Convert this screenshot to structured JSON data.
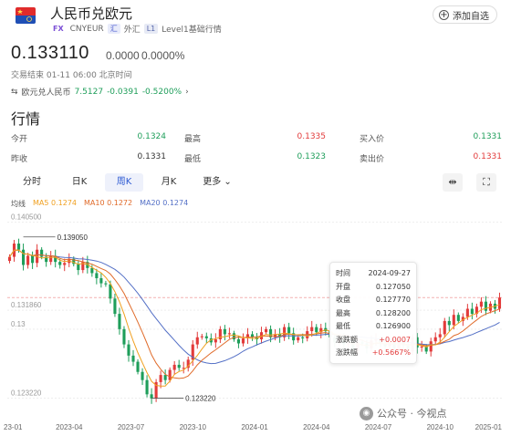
{
  "header": {
    "title": "人民币兑欧元",
    "fx_badge": "FX",
    "code": "CNYEUR",
    "market_badge": "外汇",
    "market_icon": "foreign-exchange-icon",
    "level_badge": "Level1基础行情",
    "level_icon": "level1-icon",
    "add_label": "添加自选"
  },
  "quote": {
    "price": "0.133110",
    "change": "0.0000",
    "change_pct": "0.0000%",
    "trade_status": "交易结束 01-11 06:00 北京时间",
    "related_label": "欧元兑人民币",
    "related_price": "7.5127",
    "related_change": "-0.0391",
    "related_change_pct": "-0.5200%"
  },
  "section_title": "行情",
  "stats": {
    "open_label": "今开",
    "open_value": "0.1324",
    "high_label": "最高",
    "high_value": "0.1335",
    "buy_label": "买入价",
    "buy_value": "0.1331",
    "prev_label": "昨收",
    "prev_value": "0.1331",
    "low_label": "最低",
    "low_value": "0.1323",
    "sell_label": "卖出价",
    "sell_value": "0.1331"
  },
  "tabs": {
    "timeshare": "分时",
    "day": "日K",
    "week": "周K",
    "month": "月K",
    "more": "更多",
    "active": "周K"
  },
  "legend": {
    "ma_label": "均线",
    "ma5": "MA5 0.1274",
    "ma10": "MA10 0.1272",
    "ma20": "MA20 0.1274"
  },
  "colors": {
    "up": "#e23b3b",
    "down": "#1e9e5a",
    "ma5": "#f0a020",
    "ma10": "#e06b2a",
    "ma20": "#5470c6",
    "accent": "#2f5bd3"
  },
  "tooltip": {
    "time_label": "时间",
    "time_value": "2024-09-27",
    "open_label": "开盘",
    "open_value": "0.127050",
    "close_label": "收盘",
    "close_value": "0.127770",
    "high_label": "最高",
    "high_value": "0.128200",
    "low_label": "最低",
    "low_value": "0.126900",
    "chg_label": "涨跌额",
    "chg_value": "+0.0007",
    "pct_label": "涨跌幅",
    "pct_value": "+0.5667%"
  },
  "watermark": "公众号 · 今视点",
  "chart_data": {
    "type": "candlestick",
    "ylim": [
      0.1213,
      0.141
    ],
    "y_ticks": [
      "0.140500",
      "0.131860",
      "0.13",
      "0.123220"
    ],
    "y_tick_values": [
      0.1405,
      0.13186,
      0.13,
      0.12322
    ],
    "x_ticks": [
      "23-01",
      "2023-04",
      "2023-07",
      "2023-10",
      "2024-01",
      "2024-04",
      "2024-07",
      "2024-10",
      "2025-01"
    ],
    "annotations": [
      {
        "label": "0.139050",
        "value": 0.13905,
        "x": "2023-01"
      },
      {
        "label": "0.123220",
        "value": 0.12322,
        "x": "2023-07"
      }
    ],
    "reference_line": 0.1331,
    "closes": [
      0.1371,
      0.1384,
      0.1378,
      0.1363,
      0.1372,
      0.1365,
      0.1378,
      0.1371,
      0.1366,
      0.1372,
      0.1366,
      0.1363,
      0.1365,
      0.1369,
      0.1364,
      0.1358,
      0.1366,
      0.136,
      0.1355,
      0.135,
      0.1345,
      0.1344,
      0.133,
      0.1315,
      0.13,
      0.1285,
      0.1274,
      0.1268,
      0.1258,
      0.125,
      0.1236,
      0.1232,
      0.1248,
      0.1255,
      0.125,
      0.126,
      0.1265,
      0.1262,
      0.1262,
      0.127,
      0.1285,
      0.1292,
      0.1293,
      0.1291,
      0.1287,
      0.129,
      0.13,
      0.1295,
      0.1296,
      0.129,
      0.1286,
      0.1291,
      0.1295,
      0.1292,
      0.129,
      0.1297,
      0.13,
      0.1292,
      0.1295,
      0.1292,
      0.1302,
      0.1296,
      0.1289,
      0.1292,
      0.1291,
      0.1298,
      0.1302,
      0.1297,
      0.1301,
      0.1298,
      0.1292,
      0.1287,
      0.129,
      0.1285,
      0.1286,
      0.1279,
      0.1287,
      0.1286,
      0.1281,
      0.1289,
      0.129,
      0.1286,
      0.1283,
      0.1288,
      0.1281,
      0.1288,
      0.1284,
      0.1278,
      0.1292,
      0.1282,
      0.1283,
      0.1278,
      0.1288,
      0.1292,
      0.1295,
      0.1308,
      0.1304,
      0.1314,
      0.1308,
      0.1312,
      0.132,
      0.1315,
      0.1322,
      0.1327,
      0.1318,
      0.1325,
      0.132,
      0.1331
    ],
    "volatility": 0.0006
  }
}
